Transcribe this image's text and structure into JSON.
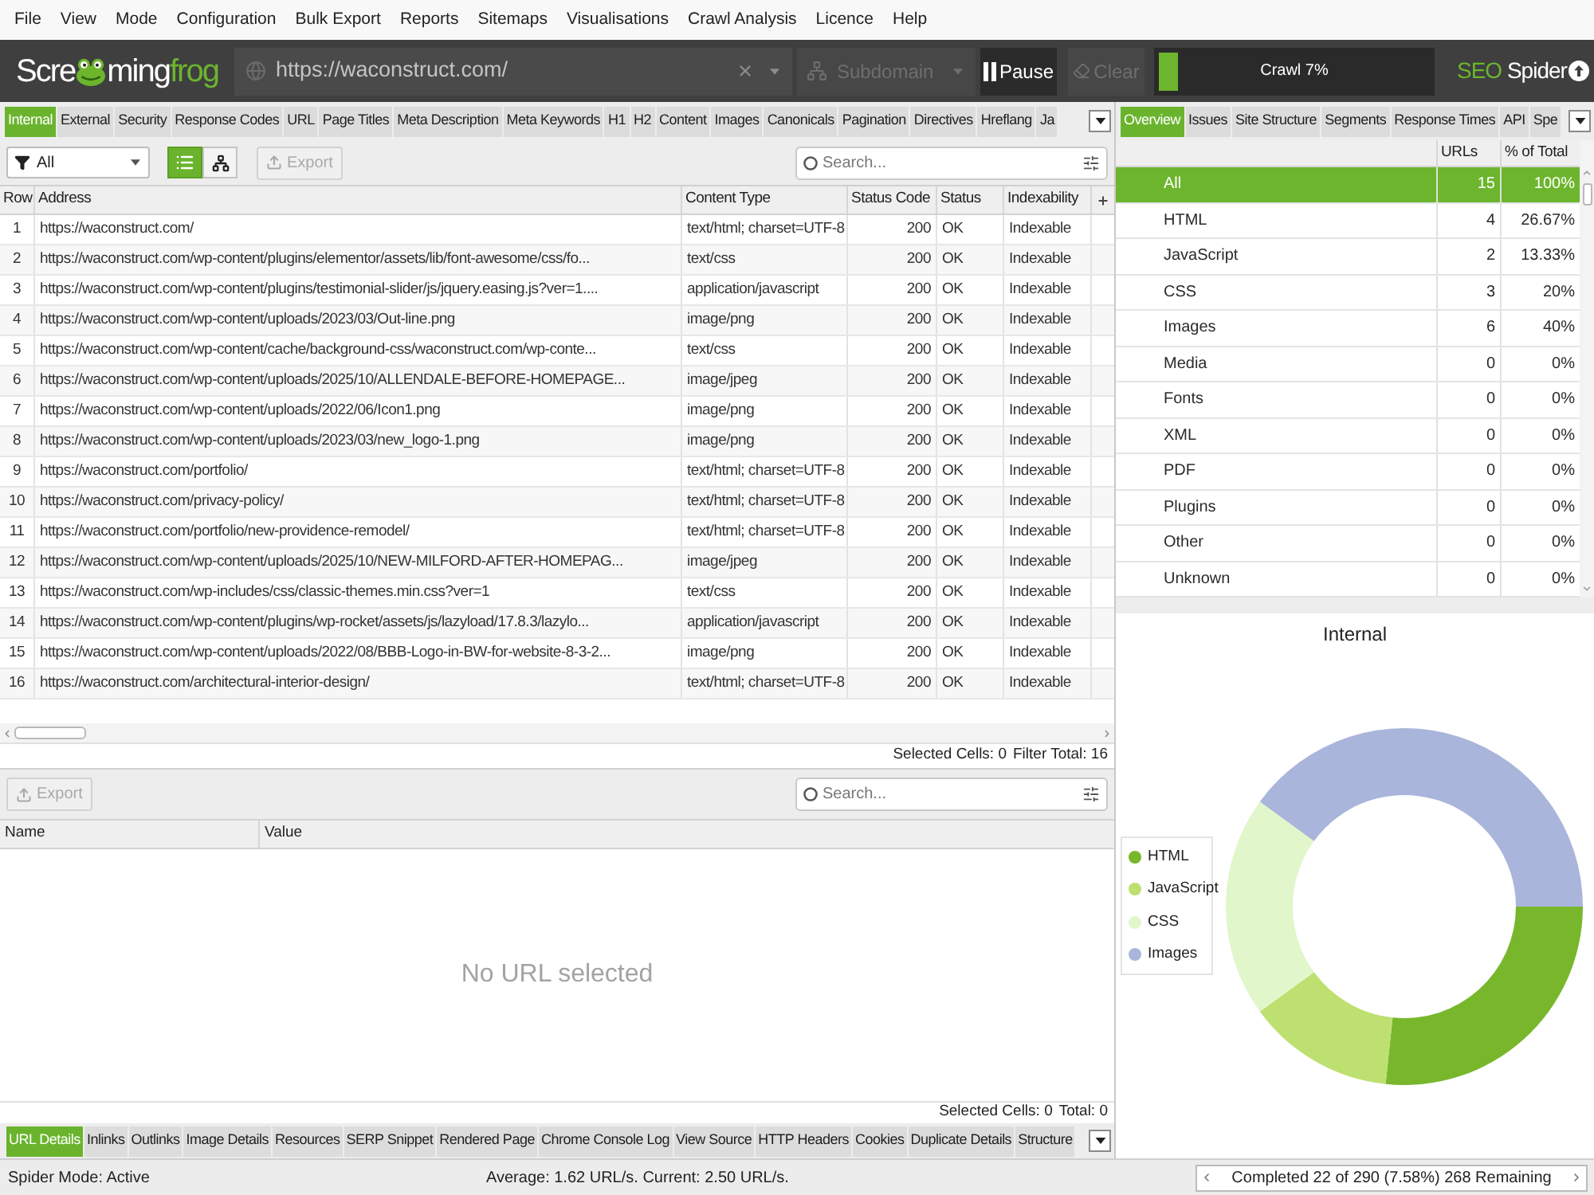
{
  "menu_bar": [
    "File",
    "View",
    "Mode",
    "Configuration",
    "Bulk Export",
    "Reports",
    "Sitemaps",
    "Visualisations",
    "Crawl Analysis",
    "Licence",
    "Help"
  ],
  "toolbar": {
    "logo": {
      "start": "Scre",
      "end": "ming",
      "accent": "frog"
    },
    "url_field": {
      "value": "https://waconstruct.com/"
    },
    "mode_dropdown": {
      "value": "Subdomain",
      "disabled": true
    },
    "buttons": [
      {
        "kind": "pause",
        "label": "Pause",
        "disabled": false
      },
      {
        "kind": "clear",
        "label": "Clear",
        "disabled": true
      }
    ],
    "progress": {
      "label": "Crawl 7%",
      "level": 0.07
    },
    "product": {
      "accent": "SEO",
      "name": "Spider"
    }
  },
  "main_tabs": [
    {
      "label": "Internal",
      "selected": true
    },
    {
      "label": "External",
      "selected": false
    },
    {
      "label": "Security",
      "selected": false
    },
    {
      "label": "Response Codes",
      "selected": false
    },
    {
      "label": "URL",
      "selected": false
    },
    {
      "label": "Page Titles",
      "selected": false
    },
    {
      "label": "Meta Description",
      "selected": false
    },
    {
      "label": "Meta Keywords",
      "selected": false
    },
    {
      "label": "H1",
      "selected": false
    },
    {
      "label": "H2",
      "selected": false
    },
    {
      "label": "Content",
      "selected": false
    },
    {
      "label": "Images",
      "selected": false
    },
    {
      "label": "Canonicals",
      "selected": false
    },
    {
      "label": "Pagination",
      "selected": false
    },
    {
      "label": "Directives",
      "selected": false
    },
    {
      "label": "Hreflang",
      "selected": false
    },
    {
      "label": "Ja",
      "selected": false
    }
  ],
  "main_toolbar": {
    "filter": {
      "value": "All"
    },
    "view_modes": [
      {
        "kind": "list",
        "selected": true
      },
      {
        "kind": "tree",
        "selected": false
      }
    ],
    "export_button": {
      "label": "Export",
      "disabled": true
    },
    "search": {
      "placeholder": "Search..."
    }
  },
  "table": {
    "columns": [
      "Row",
      "Address",
      "Content Type",
      "Status Code",
      "Status",
      "Indexability"
    ],
    "rows": [
      {
        "row": "1",
        "address": "https://waconstruct.com/",
        "content_type": "text/html; charset=UTF-8",
        "status_code": "200",
        "status": "OK",
        "indexability": "Indexable"
      },
      {
        "row": "2",
        "address": "https://waconstruct.com/wp-content/plugins/elementor/assets/lib/font-awesome/css/fo...",
        "content_type": "text/css",
        "status_code": "200",
        "status": "OK",
        "indexability": "Indexable"
      },
      {
        "row": "3",
        "address": "https://waconstruct.com/wp-content/plugins/testimonial-slider/js/jquery.easing.js?ver=1....",
        "content_type": "application/javascript",
        "status_code": "200",
        "status": "OK",
        "indexability": "Indexable"
      },
      {
        "row": "4",
        "address": "https://waconstruct.com/wp-content/uploads/2023/03/Out-line.png",
        "content_type": "image/png",
        "status_code": "200",
        "status": "OK",
        "indexability": "Indexable"
      },
      {
        "row": "5",
        "address": "https://waconstruct.com/wp-content/cache/background-css/waconstruct.com/wp-conte...",
        "content_type": "text/css",
        "status_code": "200",
        "status": "OK",
        "indexability": "Indexable"
      },
      {
        "row": "6",
        "address": "https://waconstruct.com/wp-content/uploads/2025/10/ALLENDALE-BEFORE-HOMEPAGE...",
        "content_type": "image/jpeg",
        "status_code": "200",
        "status": "OK",
        "indexability": "Indexable"
      },
      {
        "row": "7",
        "address": "https://waconstruct.com/wp-content/uploads/2022/06/Icon1.png",
        "content_type": "image/png",
        "status_code": "200",
        "status": "OK",
        "indexability": "Indexable"
      },
      {
        "row": "8",
        "address": "https://waconstruct.com/wp-content/uploads/2023/03/new_logo-1.png",
        "content_type": "image/png",
        "status_code": "200",
        "status": "OK",
        "indexability": "Indexable"
      },
      {
        "row": "9",
        "address": "https://waconstruct.com/portfolio/",
        "content_type": "text/html; charset=UTF-8",
        "status_code": "200",
        "status": "OK",
        "indexability": "Indexable"
      },
      {
        "row": "10",
        "address": "https://waconstruct.com/privacy-policy/",
        "content_type": "text/html; charset=UTF-8",
        "status_code": "200",
        "status": "OK",
        "indexability": "Indexable"
      },
      {
        "row": "11",
        "address": "https://waconstruct.com/portfolio/new-providence-remodel/",
        "content_type": "text/html; charset=UTF-8",
        "status_code": "200",
        "status": "OK",
        "indexability": "Indexable"
      },
      {
        "row": "12",
        "address": "https://waconstruct.com/wp-content/uploads/2025/10/NEW-MILFORD-AFTER-HOMEPAG...",
        "content_type": "image/jpeg",
        "status_code": "200",
        "status": "OK",
        "indexability": "Indexable"
      },
      {
        "row": "13",
        "address": "https://waconstruct.com/wp-includes/css/classic-themes.min.css?ver=1",
        "content_type": "text/css",
        "status_code": "200",
        "status": "OK",
        "indexability": "Indexable"
      },
      {
        "row": "14",
        "address": "https://waconstruct.com/wp-content/plugins/wp-rocket/assets/js/lazyload/17.8.3/lazylo...",
        "content_type": "application/javascript",
        "status_code": "200",
        "status": "OK",
        "indexability": "Indexable"
      },
      {
        "row": "15",
        "address": "https://waconstruct.com/wp-content/uploads/2022/08/BBB-Logo-in-BW-for-website-8-3-2...",
        "content_type": "image/png",
        "status_code": "200",
        "status": "OK",
        "indexability": "Indexable"
      },
      {
        "row": "16",
        "address": "https://waconstruct.com/architectural-interior-design/",
        "content_type": "text/html; charset=UTF-8",
        "status_code": "200",
        "status": "OK",
        "indexability": "Indexable"
      }
    ]
  },
  "table_footer": [
    "Selected Cells: 0",
    "Filter Total: 16"
  ],
  "details": {
    "export_button": {
      "label": "Export",
      "disabled": true
    },
    "search": {
      "placeholder": "Search..."
    },
    "columns": [
      "Name",
      "Value"
    ],
    "empty_message": "No URL selected",
    "footer": [
      "Selected Cells: 0",
      "Total: 0"
    ]
  },
  "detail_tabs": [
    {
      "label": "URL Details",
      "selected": true
    },
    {
      "label": "Inlinks",
      "selected": false
    },
    {
      "label": "Outlinks",
      "selected": false
    },
    {
      "label": "Image Details",
      "selected": false
    },
    {
      "label": "Resources",
      "selected": false
    },
    {
      "label": "SERP Snippet",
      "selected": false
    },
    {
      "label": "Rendered Page",
      "selected": false
    },
    {
      "label": "Chrome Console Log",
      "selected": false
    },
    {
      "label": "View Source",
      "selected": false
    },
    {
      "label": "HTTP Headers",
      "selected": false
    },
    {
      "label": "Cookies",
      "selected": false
    },
    {
      "label": "Duplicate Details",
      "selected": false
    },
    {
      "label": "Structure",
      "selected": false
    }
  ],
  "side_tabs": [
    {
      "label": "Overview",
      "selected": true
    },
    {
      "label": "Issues",
      "selected": false
    },
    {
      "label": "Site Structure",
      "selected": false
    },
    {
      "label": "Segments",
      "selected": false
    },
    {
      "label": "Response Times",
      "selected": false
    },
    {
      "label": "API",
      "selected": false
    },
    {
      "label": "Spe",
      "selected": false
    }
  ],
  "overview": {
    "columns": [
      "URLs",
      "% of Total"
    ],
    "rows": [
      {
        "label": "All",
        "urls": "15",
        "percent": "100%",
        "selected": true
      },
      {
        "label": "HTML",
        "urls": "4",
        "percent": "26.67%",
        "selected": false
      },
      {
        "label": "JavaScript",
        "urls": "2",
        "percent": "13.33%",
        "selected": false
      },
      {
        "label": "CSS",
        "urls": "3",
        "percent": "20%",
        "selected": false
      },
      {
        "label": "Images",
        "urls": "6",
        "percent": "40%",
        "selected": false
      },
      {
        "label": "Media",
        "urls": "0",
        "percent": "0%",
        "selected": false
      },
      {
        "label": "Fonts",
        "urls": "0",
        "percent": "0%",
        "selected": false
      },
      {
        "label": "XML",
        "urls": "0",
        "percent": "0%",
        "selected": false
      },
      {
        "label": "PDF",
        "urls": "0",
        "percent": "0%",
        "selected": false
      },
      {
        "label": "Plugins",
        "urls": "0",
        "percent": "0%",
        "selected": false
      },
      {
        "label": "Other",
        "urls": "0",
        "percent": "0%",
        "selected": false
      },
      {
        "label": "Unknown",
        "urls": "0",
        "percent": "0%",
        "selected": false
      }
    ]
  },
  "chart_panel": {
    "chart_data": [
      {
        "type": "donut",
        "title": "Internal",
        "categories": [
          "HTML",
          "JavaScript",
          "CSS",
          "Images"
        ],
        "values": [
          26.67,
          13.33,
          20,
          40
        ],
        "colors": [
          "#78b72c",
          "#bde070",
          "#e1f6ca",
          "#a9b5da"
        ],
        "legend": "left"
      }
    ]
  },
  "status_bar": {
    "mode": "Spider Mode: Active",
    "speed": "Average: 1.62 URL/s. Current: 2.50 URL/s.",
    "progress": "Completed 22 of 290 (7.58%) 268 Remaining"
  }
}
